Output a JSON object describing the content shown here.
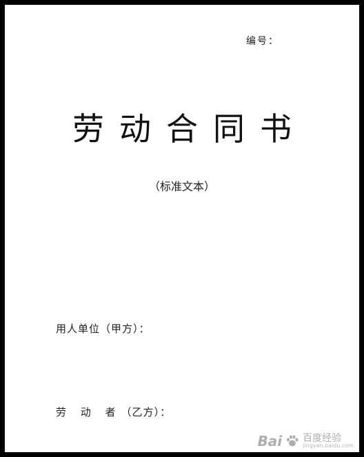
{
  "document": {
    "serial_label": "编号：",
    "title": "劳动合同书",
    "subtitle": "（标准文本）",
    "party_a_label": "用人单位（甲方）：",
    "party_b_label_prefix": "劳 动 者",
    "party_b_label_suffix": "（乙方）："
  },
  "watermark": {
    "logo_text": "Bai",
    "logo_text2": "百度",
    "jingyan_text": "经验",
    "jingyan_url": "jingyan.baidu.com"
  },
  "colors": {
    "frame": "#000000",
    "paper": "#ffffff",
    "text": "#222222"
  }
}
